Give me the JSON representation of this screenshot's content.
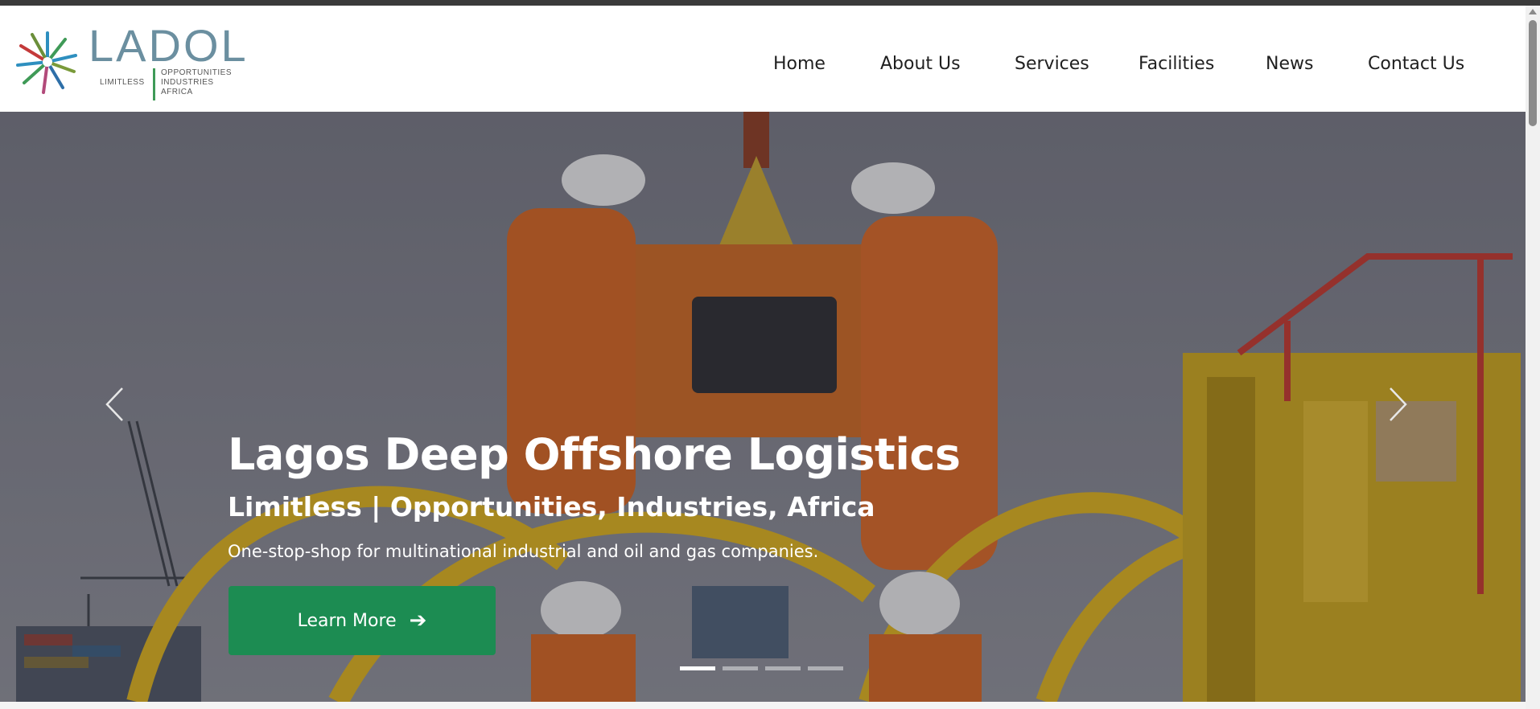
{
  "logo": {
    "wordmark": "LADOL",
    "tagline_left": "LIMITLESS",
    "tagline_right": [
      "OPPORTUNITIES",
      "INDUSTRIES",
      "AFRICA"
    ]
  },
  "nav": {
    "items": [
      {
        "label": "Home"
      },
      {
        "label": "About Us"
      },
      {
        "label": "Services"
      },
      {
        "label": "Facilities"
      },
      {
        "label": "News"
      },
      {
        "label": "Contact Us"
      }
    ]
  },
  "hero": {
    "title": "Lagos Deep Offshore Logistics",
    "subtitle": "Limitless | Opportunities, Industries, Africa",
    "description": "One-stop-shop for multinational industrial and oil and gas companies.",
    "cta_label": "Learn More",
    "cta_icon": "arrow-right-icon",
    "slides_total": 4,
    "active_slide": 1
  },
  "colors": {
    "accent_green": "#1c8c52",
    "nav_text": "#1f1f1f",
    "topbar": "#3a3a3a"
  }
}
